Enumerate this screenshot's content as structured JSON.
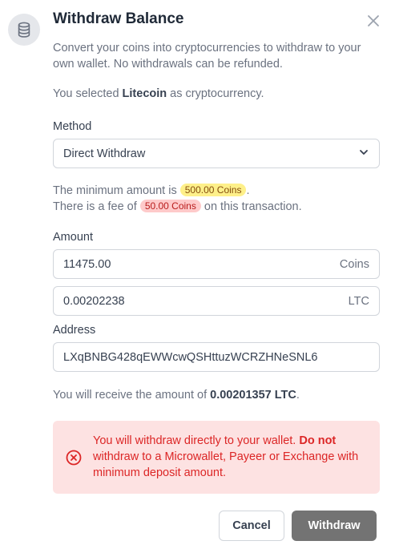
{
  "dialog": {
    "title": "Withdraw Balance",
    "description": "Convert your coins into cryptocurrencies to withdraw to your own wallet. No withdrawals can be refunded.",
    "selected_prefix": "You selected ",
    "selected_crypto": "Litecoin",
    "selected_suffix": " as cryptocurrency."
  },
  "method": {
    "label": "Method",
    "value": "Direct Withdraw"
  },
  "notes": {
    "minimum_prefix": "The minimum amount is ",
    "minimum_value": "500.00 Coins",
    "minimum_suffix": ".",
    "fee_prefix": "There is a fee of ",
    "fee_value": "50.00 Coins",
    "fee_suffix": " on this transaction."
  },
  "amount": {
    "label": "Amount",
    "coins_value": "11475.00",
    "coins_unit": "Coins",
    "crypto_value": "0.00202238",
    "crypto_unit": "LTC"
  },
  "address": {
    "label": "Address",
    "value": "LXqBNBG428qEWWcwQSHttuzWCRZHNeSNL6"
  },
  "receive": {
    "prefix": "You will receive the amount of ",
    "amount": "0.00201357 LTC",
    "suffix": "."
  },
  "alert": {
    "text_main": "You will withdraw directly to your wallet. ",
    "text_bold": "Do not",
    "text_rest": " withdraw to a Microwallet, Payeer or Exchange with minimum deposit amount.",
    "color": "#dc2626",
    "background": "#fde2e2"
  },
  "buttons": {
    "cancel": "Cancel",
    "withdraw": "Withdraw"
  },
  "icons": {
    "header": "coins-stack-icon",
    "close": "close-icon",
    "select": "chevron-down-icon",
    "alert": "error-circle-icon"
  }
}
